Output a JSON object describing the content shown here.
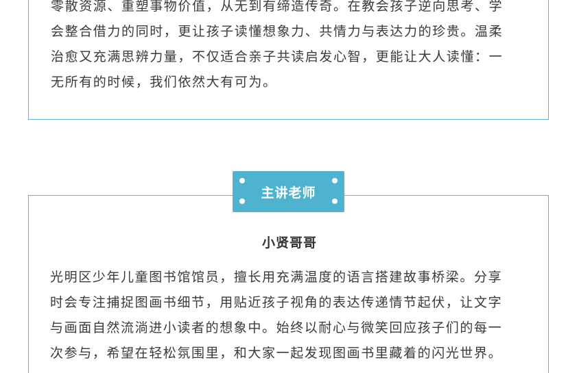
{
  "intro": {
    "lines": [
      "零散资源、重塑事物价值，从无到有缔造传奇。在教会孩子逆向思考、学",
      "会整合借力的同时，更让孩子读懂想象力、共情力与表达力的珍贵。温柔",
      "治愈又充满思辨力量，不仅适合亲子共读启发心智，更能让大人读懂：一",
      "无所有的时候，我们依然大有可为。"
    ]
  },
  "host_section": {
    "label": "主讲老师",
    "name": "小贤哥哥",
    "lines": [
      "光明区少年儿童图书馆馆员，擅长用充满温度的语言搭建故事桥梁。分享",
      "时会专注捕捉图画书细节，用贴近孩子视角的表达传递情节起伏，让文字",
      "与画面自然流淌进小读者的想象中。始终以耐心与微笑回应孩子们的每一",
      "次参与，希望在轻松氛围里，和大家一起发现图画书里藏着的闪光世界。"
    ]
  },
  "colors": {
    "accent": "#4fb3cf",
    "border": "#5cb6cc",
    "text": "#3a3a3a"
  }
}
